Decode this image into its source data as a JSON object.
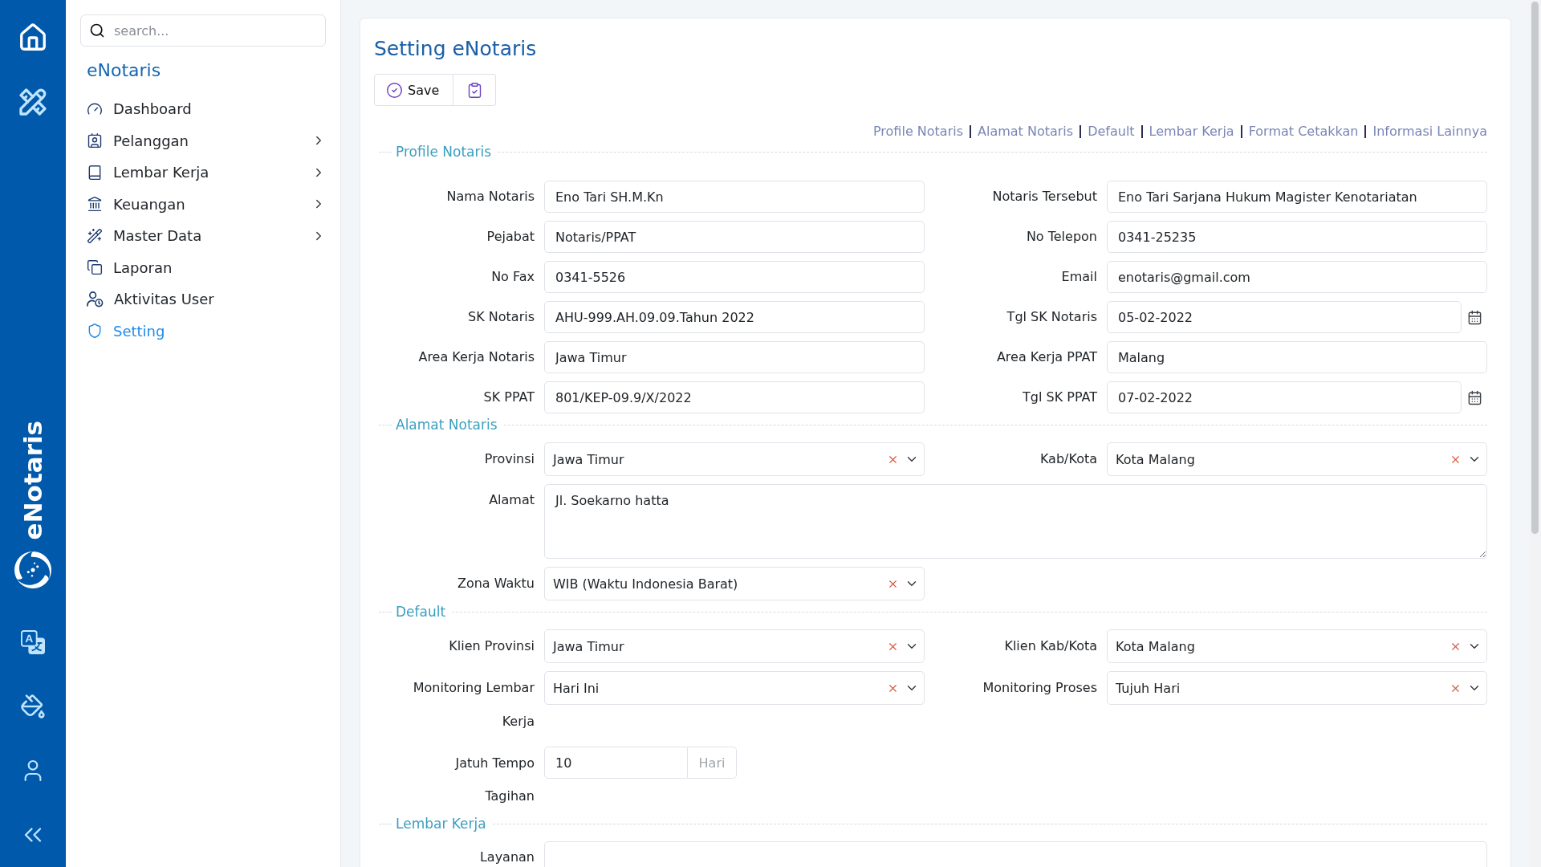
{
  "nav_rail": {
    "logo_text": "eNotaris"
  },
  "sidebar": {
    "search": {
      "placeholder": "search..."
    },
    "title": "eNotaris",
    "items": [
      {
        "label": "Dashboard",
        "has_submenu": false,
        "selected": false
      },
      {
        "label": "Pelanggan",
        "has_submenu": true,
        "selected": false
      },
      {
        "label": "Lembar Kerja",
        "has_submenu": true,
        "selected": false
      },
      {
        "label": "Keuangan",
        "has_submenu": true,
        "selected": false
      },
      {
        "label": "Master Data",
        "has_submenu": true,
        "selected": false
      },
      {
        "label": "Laporan",
        "has_submenu": false,
        "selected": false
      },
      {
        "label": "Aktivitas User",
        "has_submenu": false,
        "selected": false
      },
      {
        "label": "Setting",
        "has_submenu": false,
        "selected": true
      }
    ]
  },
  "page": {
    "title": "Setting eNotaris",
    "toolbar": {
      "save_label": "Save"
    },
    "section_links": [
      "Profile Notaris",
      "Alamat Notaris",
      "Default",
      "Lembar Kerja",
      "Format Cetakkan",
      "Informasi Lainnya"
    ],
    "sections": [
      {
        "legend": "Profile Notaris",
        "rows": [
          {
            "fields": [
              {
                "kind": "text",
                "label": "Nama Notaris",
                "value": "Eno Tari SH.M.Kn"
              },
              {
                "kind": "text",
                "label": "Notaris Tersebut",
                "value": "Eno Tari Sarjana Hukum Magister Kenotariatan"
              }
            ]
          },
          {
            "fields": [
              {
                "kind": "text",
                "label": "Pejabat",
                "value": "Notaris/PPAT"
              },
              {
                "kind": "text",
                "label": "No Telepon",
                "value": "0341-25235"
              }
            ]
          },
          {
            "fields": [
              {
                "kind": "text",
                "label": "No Fax",
                "value": "0341-5526"
              },
              {
                "kind": "text",
                "label": "Email",
                "value": "enotaris@gmail.com"
              }
            ]
          },
          {
            "fields": [
              {
                "kind": "text",
                "label": "SK Notaris",
                "value": "AHU-999.AH.09.09.Tahun 2022"
              },
              {
                "kind": "date",
                "label": "Tgl SK Notaris",
                "value": "05-02-2022"
              }
            ]
          },
          {
            "fields": [
              {
                "kind": "text",
                "label": "Area Kerja Notaris",
                "value": "Jawa Timur"
              },
              {
                "kind": "text",
                "label": "Area Kerja PPAT",
                "value": "Malang"
              }
            ]
          },
          {
            "fields": [
              {
                "kind": "text",
                "label": "SK PPAT",
                "value": "801/KEP-09.9/X/2022"
              },
              {
                "kind": "date",
                "label": "Tgl SK PPAT",
                "value": "07-02-2022"
              }
            ]
          }
        ]
      },
      {
        "legend": "Alamat Notaris",
        "rows": [
          {
            "fields": [
              {
                "kind": "select",
                "label": "Provinsi",
                "value": "Jawa Timur"
              },
              {
                "kind": "select",
                "label": "Kab/Kota",
                "value": "Kota Malang"
              }
            ]
          },
          {
            "fields": [
              {
                "kind": "textarea",
                "label": "Alamat",
                "value": "Jl. Soekarno hatta"
              }
            ]
          },
          {
            "fields": [
              {
                "kind": "select",
                "label": "Zona Waktu",
                "value": "WIB (Waktu Indonesia Barat)"
              }
            ]
          }
        ]
      },
      {
        "legend": "Default",
        "rows": [
          {
            "fields": [
              {
                "kind": "select",
                "label": "Klien Provinsi",
                "value": "Jawa Timur"
              },
              {
                "kind": "select",
                "label": "Klien Kab/Kota",
                "value": "Kota Malang"
              }
            ]
          },
          {
            "fields": [
              {
                "kind": "select",
                "label": "Monitoring Lembar Kerja",
                "value": "Hari Ini"
              },
              {
                "kind": "select",
                "label": "Monitoring Proses",
                "value": "Tujuh Hari"
              }
            ]
          },
          {
            "fields": [
              {
                "kind": "addon",
                "label": "Jatuh Tempo Tagihan",
                "value": "10",
                "addon": "Hari"
              }
            ]
          }
        ]
      },
      {
        "legend": "Lembar Kerja",
        "rows": [
          {
            "fields": [
              {
                "kind": "textarea",
                "label": "Layanan"
              }
            ]
          }
        ]
      }
    ]
  }
}
